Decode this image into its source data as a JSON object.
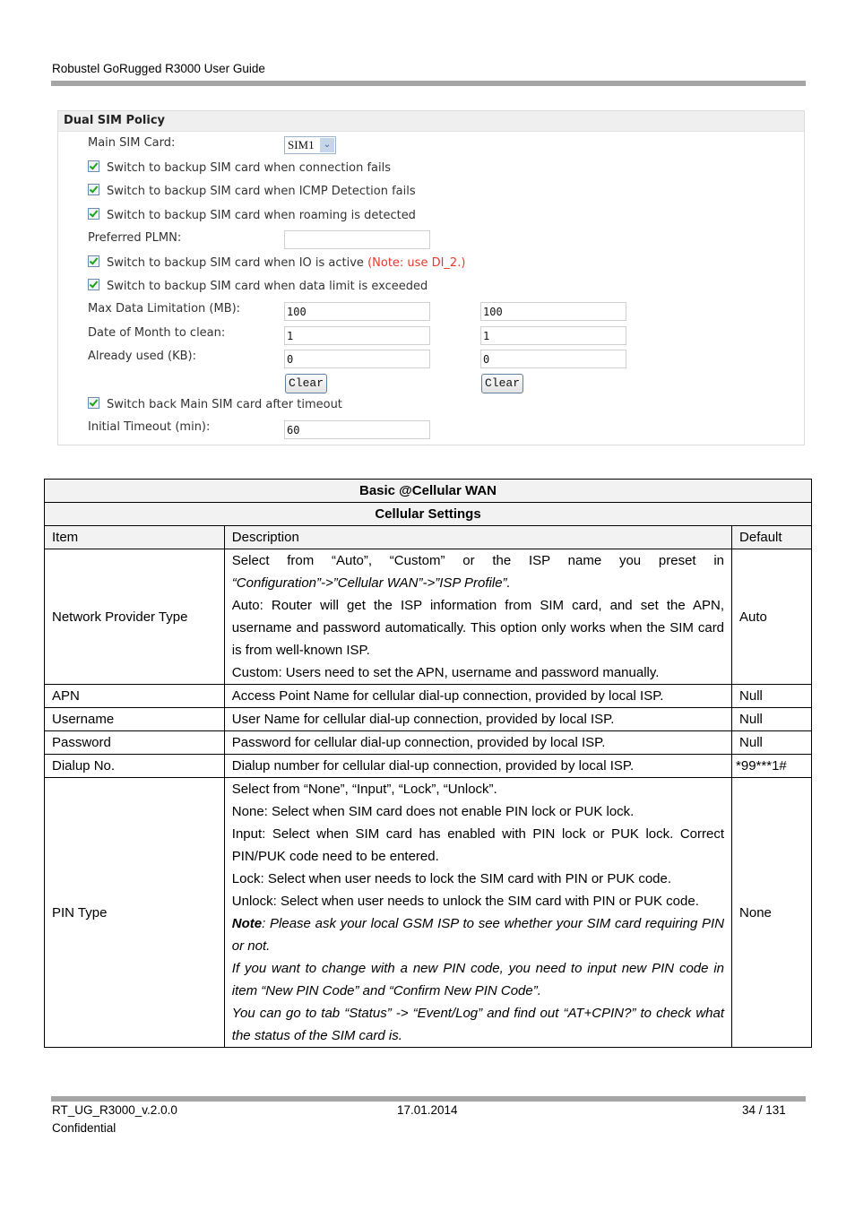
{
  "header": {
    "title": "Robustel GoRugged R3000 User Guide"
  },
  "panel": {
    "title": "Dual SIM Policy",
    "main_sim_label": "Main SIM Card:",
    "main_sim_value": "SIM1",
    "checkboxes": [
      {
        "label": "Switch to backup SIM card when connection fails",
        "checked": true
      },
      {
        "label": "Switch to backup SIM card when ICMP Detection fails",
        "checked": true
      },
      {
        "label": "Switch to backup SIM card when roaming is detected",
        "checked": true
      },
      {
        "label": "Switch to backup SIM card when IO is active",
        "note": "(Note: use DI_2.)",
        "checked": true
      },
      {
        "label": "Switch to backup SIM card when data limit is exceeded",
        "checked": true
      },
      {
        "label": "Switch back Main SIM card after timeout",
        "checked": true
      }
    ],
    "preferred_plmn_label": "Preferred PLMN:",
    "preferred_plmn_value": "",
    "max_data_label": "Max Data Limitation (MB):",
    "max_data_sim1": "100",
    "max_data_sim2": "100",
    "date_clean_label": "Date of Month to clean:",
    "date_clean_sim1": "1",
    "date_clean_sim2": "1",
    "already_used_label": "Already used (KB):",
    "already_used_sim1": "0",
    "already_used_sim2": "0",
    "clear_label": "Clear",
    "initial_timeout_label": "Initial Timeout (min):",
    "initial_timeout_value": "60"
  },
  "table": {
    "title": "Basic @Cellular WAN",
    "subtitle": "Cellular Settings",
    "columns": [
      "Item",
      "Description",
      "Default"
    ],
    "rows": [
      {
        "item": "Network Provider Type",
        "desc": [
          "Select from “Auto”, “Custom” or the ISP name you preset in",
          "“Configuration”->”Cellular WAN”->”ISP Profile”.",
          "Auto: Router will get the ISP information from SIM card, and set the APN, username and password automatically. This option only works when the SIM card is from well-known ISP.",
          "Custom: Users need to set the APN, username and password manually."
        ],
        "default": "Auto"
      },
      {
        "item": "APN",
        "desc": [
          "Access Point Name for cellular dial-up connection, provided by local ISP."
        ],
        "default": "Null"
      },
      {
        "item": "Username",
        "desc": [
          "User Name for cellular dial-up connection, provided by local ISP."
        ],
        "default": "Null"
      },
      {
        "item": "Password",
        "desc": [
          "Password for cellular dial-up connection, provided by local ISP."
        ],
        "default": "Null"
      },
      {
        "item": "Dialup No.",
        "desc": [
          "Dialup number for cellular dial-up connection, provided by local ISP."
        ],
        "default": "*99***1#"
      },
      {
        "item": "PIN Type",
        "desc": [
          "Select from “None”, “Input”, “Lock”, “Unlock”.",
          "None: Select when SIM card does not enable PIN lock or PUK lock.",
          "Input: Select when SIM card has enabled with PIN lock or PUK lock. Correct PIN/PUK code need to be entered.",
          "Lock: Select when user needs to lock the SIM card with PIN or PUK code.",
          "Unlock: Select when user needs to unlock the SIM card with PIN or PUK code.",
          "Note",
          ": Please ask your local GSM ISP to see whether your SIM card requiring PIN or not.",
          "If you want to change with a new PIN code, you need to input new PIN code in item “New PIN Code” and “Confirm New PIN Code”.",
          "You can go to tab “Status” -> “Event/Log” and find out “AT+CPIN?” to check what the status of the SIM card is."
        ],
        "default": "None"
      }
    ]
  },
  "footer": {
    "doc_id": "RT_UG_R3000_v.2.0.0",
    "classification": "Confidential",
    "date": "17.01.2014",
    "page": "34 / 131"
  }
}
